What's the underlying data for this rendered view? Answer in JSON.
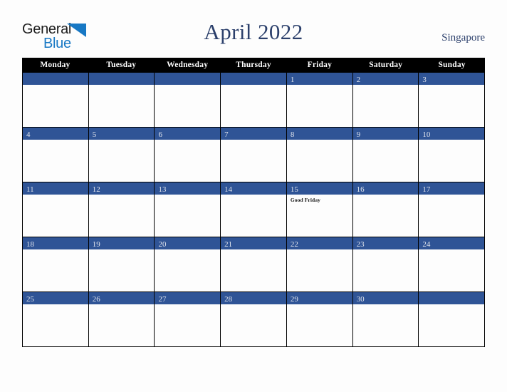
{
  "brand": {
    "name_part1": "General",
    "name_part2": "Blue",
    "flag_icon": "blue-triangle-flag-icon",
    "color_dark": "#1d1d1d",
    "color_blue": "#1878c4"
  },
  "header": {
    "title": "April 2022",
    "country": "Singapore",
    "title_color": "#2b3f6b"
  },
  "calendar": {
    "accent_color": "#2f5496",
    "header_bg": "#000000",
    "weekdays": [
      "Monday",
      "Tuesday",
      "Wednesday",
      "Thursday",
      "Friday",
      "Saturday",
      "Sunday"
    ],
    "weeks": [
      [
        {
          "day": "",
          "events": []
        },
        {
          "day": "",
          "events": []
        },
        {
          "day": "",
          "events": []
        },
        {
          "day": "",
          "events": []
        },
        {
          "day": "1",
          "events": []
        },
        {
          "day": "2",
          "events": []
        },
        {
          "day": "3",
          "events": []
        }
      ],
      [
        {
          "day": "4",
          "events": []
        },
        {
          "day": "5",
          "events": []
        },
        {
          "day": "6",
          "events": []
        },
        {
          "day": "7",
          "events": []
        },
        {
          "day": "8",
          "events": []
        },
        {
          "day": "9",
          "events": []
        },
        {
          "day": "10",
          "events": []
        }
      ],
      [
        {
          "day": "11",
          "events": []
        },
        {
          "day": "12",
          "events": []
        },
        {
          "day": "13",
          "events": []
        },
        {
          "day": "14",
          "events": []
        },
        {
          "day": "15",
          "events": [
            "Good Friday"
          ]
        },
        {
          "day": "16",
          "events": []
        },
        {
          "day": "17",
          "events": []
        }
      ],
      [
        {
          "day": "18",
          "events": []
        },
        {
          "day": "19",
          "events": []
        },
        {
          "day": "20",
          "events": []
        },
        {
          "day": "21",
          "events": []
        },
        {
          "day": "22",
          "events": []
        },
        {
          "day": "23",
          "events": []
        },
        {
          "day": "24",
          "events": []
        }
      ],
      [
        {
          "day": "25",
          "events": []
        },
        {
          "day": "26",
          "events": []
        },
        {
          "day": "27",
          "events": []
        },
        {
          "day": "28",
          "events": []
        },
        {
          "day": "29",
          "events": []
        },
        {
          "day": "30",
          "events": []
        },
        {
          "day": "",
          "events": []
        }
      ]
    ]
  }
}
